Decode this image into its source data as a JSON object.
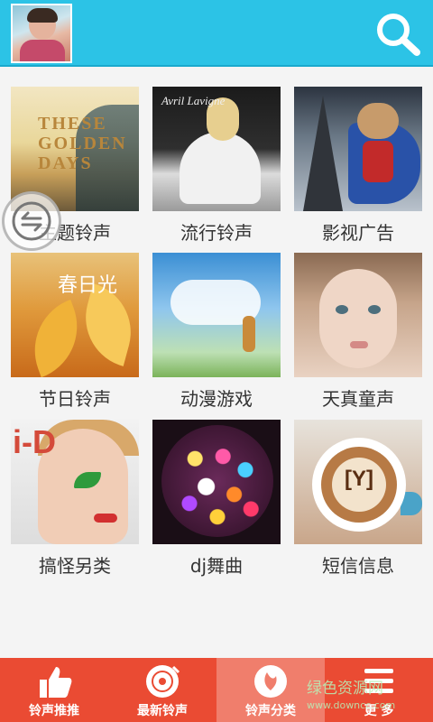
{
  "header": {
    "background_color": "#2cc3e6",
    "avatar": "user-avatar-photo",
    "search_icon": "search-icon"
  },
  "categories": [
    {
      "label": "主题铃声",
      "art_text": "THESE GOLDEN DAYS"
    },
    {
      "label": "流行铃声",
      "art_text": "Avril Lavigne"
    },
    {
      "label": "影视广告"
    },
    {
      "label": "节日铃声",
      "art_text": "春日光"
    },
    {
      "label": "动漫游戏"
    },
    {
      "label": "天真童声"
    },
    {
      "label": "搞怪另类",
      "art_text": "i-D"
    },
    {
      "label": "dj舞曲"
    },
    {
      "label": "短信信息",
      "art_text": "[Y]"
    }
  ],
  "floating_button_icon": "back-arrow-icon",
  "bottom_nav": {
    "background_color": "#ea4b33",
    "active_color": "#f07e6c",
    "items": [
      {
        "label": "铃声推推",
        "icon": "thumbs-up-icon"
      },
      {
        "label": "最新铃声",
        "icon": "disc-icon"
      },
      {
        "label": "铃声分类",
        "icon": "category-icon",
        "active": true
      },
      {
        "label": "更  多",
        "icon": "menu-icon"
      }
    ]
  },
  "watermark": {
    "line1": "绿色资源网",
    "line2": "www.downcc.com"
  }
}
